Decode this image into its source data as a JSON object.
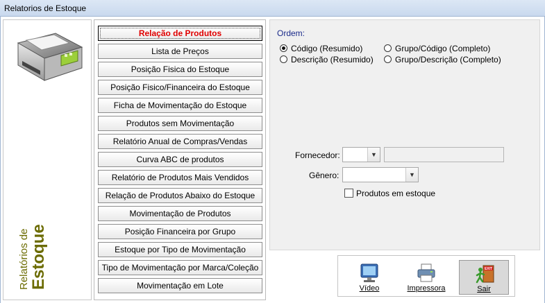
{
  "window": {
    "title": "Relatorios de Estoque"
  },
  "side": {
    "small": "Relatórios de",
    "big": "Estoque"
  },
  "menu": [
    "Relação de Produtos",
    "Lista de Preços",
    "Posição Fisica do Estoque",
    "Posição Fisico/Financeira do Estoque",
    "Ficha de Movimentação do Estoque",
    "Produtos sem Movimentação",
    "Relatório Anual de Compras/Vendas",
    "Curva ABC de produtos",
    "Relatório de Produtos Mais Vendidos",
    "Relação de Produtos Abaixo do Estoque",
    "Movimentação de Produtos",
    "Posição Financeira por Grupo",
    "Estoque por Tipo de Movimentação",
    "Tipo de Movimentação por Marca/Coleção",
    "Movimentação em Lote"
  ],
  "ordem": {
    "label": "Ordem:",
    "options": [
      {
        "label": "Código (Resumido)",
        "selected": true
      },
      {
        "label": "Grupo/Código (Completo)",
        "selected": false
      },
      {
        "label": "Descrição (Resumido)",
        "selected": false
      },
      {
        "label": "Grupo/Descrição (Completo)",
        "selected": false
      }
    ]
  },
  "filters": {
    "fornecedor_label": "Fornecedor:",
    "fornecedor_value": "",
    "fornecedor_name": "",
    "genero_label": "Gênero:",
    "genero_value": "",
    "em_estoque_label": "Produtos em estoque",
    "em_estoque_checked": false
  },
  "actions": {
    "video": "Vídeo",
    "impressora": "Impressora",
    "sair": "Sair",
    "exit_sign": "EXIT"
  }
}
